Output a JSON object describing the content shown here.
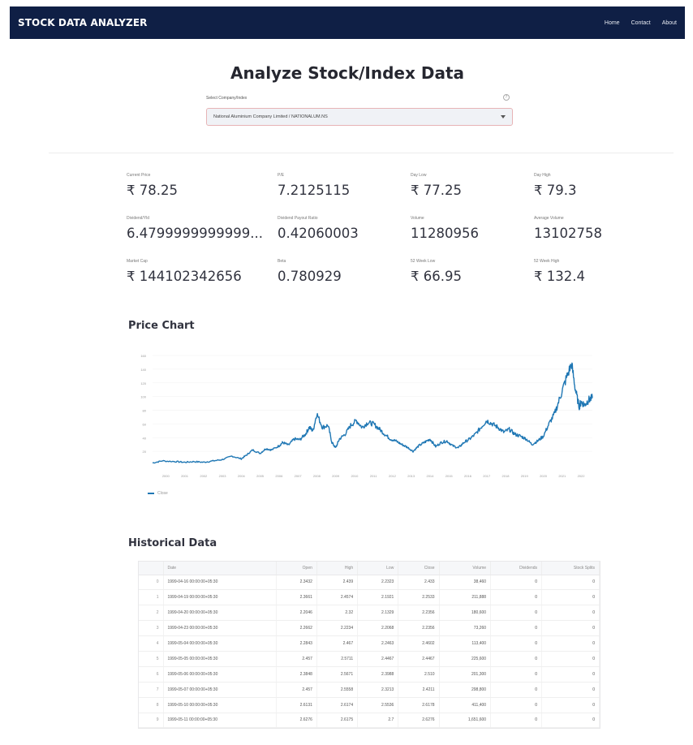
{
  "navbar": {
    "brand": "STOCK DATA ANALYZER",
    "links": [
      "Home",
      "Contact",
      "About"
    ]
  },
  "page": {
    "title": "Analyze Stock/Index Data",
    "select_label": "Select Company/Index",
    "selected_company": "National Aluminium Company Limited / NATIONALUM.NS",
    "help_glyph": "?"
  },
  "metrics": [
    {
      "label": "Current Price",
      "value": "₹ 78.25"
    },
    {
      "label": "P/E",
      "value": "7.2125115"
    },
    {
      "label": "Day Low",
      "value": "₹ 77.25"
    },
    {
      "label": "Day High",
      "value": "₹ 79.3"
    },
    {
      "label": "Dividend/Yld",
      "value": "6.4799999999999..."
    },
    {
      "label": "Dividend Payout Ratio",
      "value": "0.42060003"
    },
    {
      "label": "Volume",
      "value": "11280956"
    },
    {
      "label": "Average Volume",
      "value": "13102758"
    },
    {
      "label": "Market Cap",
      "value": "₹ 144102342656"
    },
    {
      "label": "Beta",
      "value": "0.780929"
    },
    {
      "label": "52 Week Low",
      "value": "₹ 66.95"
    },
    {
      "label": "52 Week High",
      "value": "₹ 132.4"
    }
  ],
  "sections": {
    "price_chart": "Price Chart",
    "historical": "Historical Data"
  },
  "colors": {
    "navbar": "#0f1f45",
    "line": "#1f77b4",
    "select_border": "#e7b4b6"
  },
  "chart_data": {
    "type": "line",
    "legend": "Close",
    "y_ticks": [
      "160",
      "140",
      "120",
      "100",
      "80",
      "60",
      "40",
      "20"
    ],
    "x_ticks": [
      "2000",
      "2001",
      "2002",
      "2003",
      "2004",
      "2005",
      "2006",
      "2007",
      "2008",
      "2009",
      "2010",
      "2011",
      "2012",
      "2013",
      "2014",
      "2015",
      "2016",
      "2017",
      "2018",
      "2019",
      "2020",
      "2021",
      "2022"
    ],
    "ylim": [
      0,
      160
    ],
    "xlim": [
      1999.3,
      2022.6
    ],
    "series": [
      {
        "x": [
          1999.3,
          1999.8,
          2000.5,
          2001.0,
          2001.5,
          2002.0,
          2002.5,
          2003.0,
          2003.5,
          2004.0,
          2004.3,
          2004.6,
          2005.0,
          2005.3,
          2005.6,
          2006.0,
          2006.2,
          2006.5,
          2006.8,
          2007.1,
          2007.4,
          2007.6,
          2007.8,
          2008.0,
          2008.3,
          2008.6,
          2008.8,
          2009.0,
          2009.2,
          2009.5,
          2009.8,
          2010.1,
          2010.4,
          2010.7,
          2011.0,
          2011.3,
          2011.6,
          2011.9,
          2012.2,
          2012.5,
          2012.8,
          2013.1,
          2013.4,
          2013.7,
          2014.0,
          2014.3,
          2014.6,
          2014.9,
          2015.2,
          2015.5,
          2015.8,
          2016.1,
          2016.4,
          2016.7,
          2017.0,
          2017.3,
          2017.6,
          2017.9,
          2018.2,
          2018.5,
          2018.8,
          2019.1,
          2019.4,
          2019.7,
          2020.0,
          2020.3,
          2020.6,
          2020.9,
          2021.2,
          2021.5,
          2021.7,
          2021.9,
          2022.0,
          2022.2,
          2022.4,
          2022.6
        ],
        "values": [
          3,
          6,
          5,
          4,
          5,
          4,
          6,
          8,
          13,
          9,
          15,
          22,
          17,
          24,
          22,
          28,
          33,
          29,
          38,
          37,
          45,
          55,
          50,
          75,
          55,
          58,
          33,
          25,
          38,
          45,
          58,
          65,
          55,
          62,
          60,
          53,
          45,
          38,
          35,
          30,
          26,
          20,
          28,
          33,
          38,
          27,
          33,
          35,
          28,
          25,
          33,
          38,
          45,
          55,
          65,
          60,
          55,
          48,
          52,
          45,
          42,
          38,
          30,
          35,
          42,
          60,
          75,
          100,
          125,
          148,
          110,
          85,
          92,
          88,
          95,
          98
        ]
      }
    ]
  },
  "table": {
    "columns": [
      "",
      "Date",
      "Open",
      "High",
      "Low",
      "Close",
      "Volume",
      "Dividends",
      "Stock Splits"
    ],
    "rows": [
      [
        "0",
        "1999-04-16 00:00:00+05:30",
        "2.3432",
        "2.439",
        "2.2323",
        "2.433",
        "38,460",
        "0",
        "0"
      ],
      [
        "1",
        "1999-04-19 00:00:00+05:30",
        "2.3661",
        "2.4574",
        "2.1921",
        "2.2533",
        "211,888",
        "0",
        "0"
      ],
      [
        "2",
        "1999-04-20 00:00:00+05:30",
        "2.2046",
        "2.32",
        "2.1329",
        "2.2356",
        "180,600",
        "0",
        "0"
      ],
      [
        "3",
        "1999-04-23 00:00:00+05:30",
        "2.2662",
        "2.2234",
        "2.2068",
        "2.2356",
        "73,260",
        "0",
        "0"
      ],
      [
        "4",
        "1999-05-04 00:00:00+05:30",
        "2.2843",
        "2.467",
        "2.2463",
        "2.4602",
        "113,400",
        "0",
        "0"
      ],
      [
        "5",
        "1999-05-05 00:00:00+05:30",
        "2.457",
        "2.5711",
        "2.4467",
        "2.4467",
        "225,600",
        "0",
        "0"
      ],
      [
        "6",
        "1999-05-06 00:00:00+05:30",
        "2.3848",
        "2.5671",
        "2.3988",
        "2.510",
        "201,300",
        "0",
        "0"
      ],
      [
        "7",
        "1999-05-07 00:00:00+05:30",
        "2.457",
        "2.5558",
        "2.3213",
        "2.4211",
        "298,800",
        "0",
        "0"
      ],
      [
        "8",
        "1999-05-10 00:00:00+05:30",
        "2.6131",
        "2.6174",
        "2.5536",
        "2.6178",
        "411,400",
        "0",
        "0"
      ],
      [
        "9",
        "1999-05-11 00:00:00+05:30",
        "2.6276",
        "2.6175",
        "2.7",
        "2.6276",
        "1,651,600",
        "0",
        "0"
      ]
    ]
  }
}
